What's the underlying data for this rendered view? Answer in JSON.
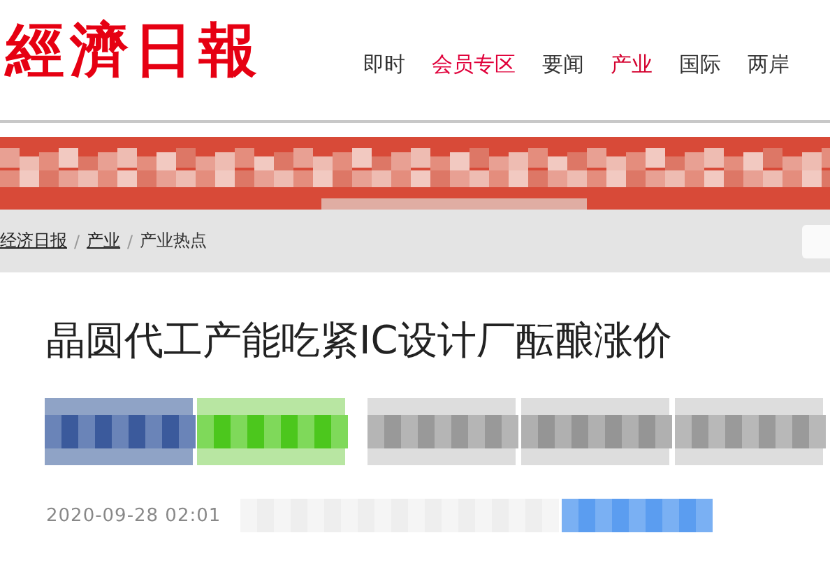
{
  "logo": {
    "text": "經濟日報"
  },
  "nav": [
    {
      "label": "即时",
      "kind": "normal",
      "selected": false
    },
    {
      "label": "会员专区",
      "kind": "member",
      "selected": false
    },
    {
      "label": "要闻",
      "kind": "normal",
      "selected": false
    },
    {
      "label": "产业",
      "kind": "normal",
      "selected": true
    },
    {
      "label": "国际",
      "kind": "normal",
      "selected": false
    },
    {
      "label": "两岸",
      "kind": "normal",
      "selected": false
    }
  ],
  "breadcrumb_separator": "/",
  "breadcrumb": [
    {
      "label": "经济日报",
      "link": true
    },
    {
      "label": "产业",
      "link": true
    },
    {
      "label": "产业热点",
      "link": false
    }
  ],
  "article": {
    "title": "晶圆代工产能吃紧IC设计厂酝酿涨价",
    "date": "2020-09-28 02:01"
  }
}
